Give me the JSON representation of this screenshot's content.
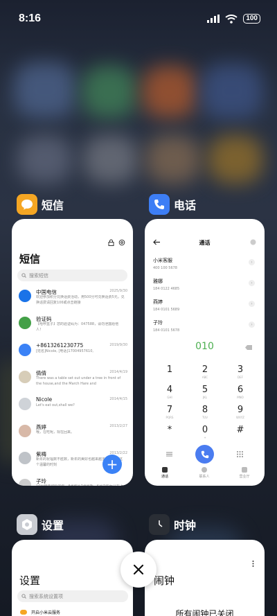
{
  "status_bar": {
    "time": "8:16",
    "battery": "100"
  },
  "colors": {
    "messages_icon": "#f5a623",
    "phone_icon": "#3d7ef5",
    "settings_icon": "#c9ccd2",
    "clock_icon": "#2a2e35",
    "fab": "#3b82f6",
    "dial_typed": "#4caf50"
  },
  "cards": {
    "messages": {
      "app_label": "短信",
      "icon": "chat-bubble-icon",
      "title": "短信",
      "search_placeholder": "搜索短信",
      "items": [
        {
          "name": "中国电信",
          "date": "2025/9/30",
          "preview": "欢迎参加积分兑换话费活动，用500分可兑换话费5元，兑换话费请回复106或点击链接",
          "avatar": "#1a73e8"
        },
        {
          "name": "验证码",
          "date": "",
          "preview": "【哈啰盒子】您的验证码为：047588，请勿泄露给他人！",
          "avatar": "#43a047"
        },
        {
          "name": "+8613261230775",
          "date": "2019/9/30",
          "preview": "[姓名]Nicole, [电话]17004957610,",
          "avatar": "#3b82f6"
        },
        {
          "name": "倩倩",
          "date": "2014/4/19",
          "preview": "There was a table set out under a tree in front of the house,and the March Hare and",
          "avatar": "#d7cdb8"
        },
        {
          "name": "Nicole",
          "date": "2014/4/15",
          "preview": "Let's eat out,shall we?",
          "avatar": "#cfd3d8"
        },
        {
          "name": "燕婷",
          "date": "2013/2/27",
          "preview": "哦，在吃呢，现在回来。",
          "avatar": "#d8b9a8"
        },
        {
          "name": "紫梅",
          "date": "2013/2/22",
          "preview": "新年的祝福数不胜数，新年的美好也越来越多越好，在这个温馨的时刻",
          "avatar": "#bfc3c8"
        },
        {
          "name": "子玲",
          "date": "",
          "preview": "10分想念可怜的你，8张照片7张最新，6月中的女儿在上班，4条大白，3只",
          "avatar": "#ccc"
        }
      ]
    },
    "phone": {
      "app_label": "电话",
      "icon": "phone-icon",
      "title": "通话",
      "contacts": [
        {
          "name": "小米客服",
          "number": "400 100 5678"
        },
        {
          "name": "雅娜",
          "number": "184 0122 4685"
        },
        {
          "name": "燕婷",
          "number": "184 0101 5689"
        },
        {
          "name": "子玲",
          "number": "184 0101 5678"
        }
      ],
      "typed": "010",
      "keys": [
        {
          "d": "1",
          "l": ""
        },
        {
          "d": "2",
          "l": "ABC"
        },
        {
          "d": "3",
          "l": "DEF"
        },
        {
          "d": "4",
          "l": "GHI"
        },
        {
          "d": "5",
          "l": "JKL"
        },
        {
          "d": "6",
          "l": "MNO"
        },
        {
          "d": "7",
          "l": "PQRS"
        },
        {
          "d": "8",
          "l": "TUV"
        },
        {
          "d": "9",
          "l": "WXYZ"
        },
        {
          "d": "*",
          "l": ""
        },
        {
          "d": "0",
          "l": "+"
        },
        {
          "d": "#",
          "l": ""
        }
      ],
      "tabs": [
        "通话",
        "联系人",
        "营业厅"
      ]
    },
    "settings": {
      "app_label": "设置",
      "icon": "gear-icon",
      "title": "设置",
      "search_placeholder": "搜索系统设置项",
      "first_item": "开启小米云服务"
    },
    "clock": {
      "app_label": "时钟",
      "icon": "clock-icon",
      "title": "闹钟",
      "message": "所有闹钟已关闭"
    }
  }
}
